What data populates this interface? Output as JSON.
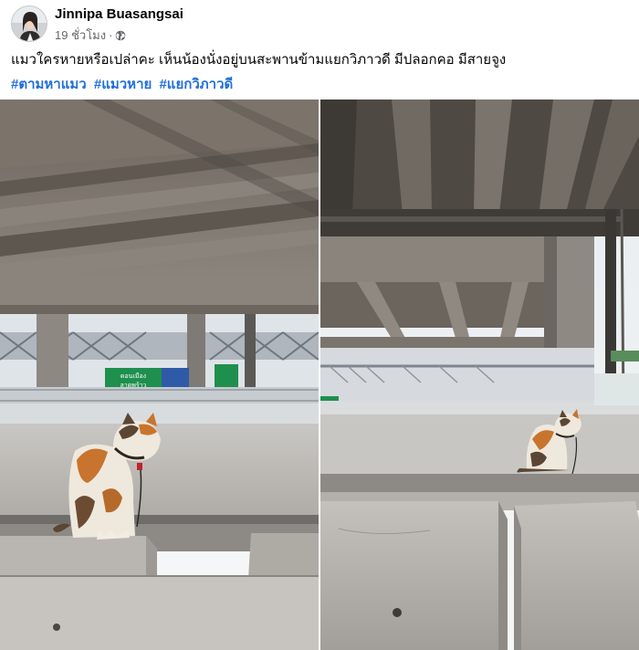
{
  "post": {
    "author_name": "Jinnipa Buasangsai",
    "timestamp": "19 ชั่วโมง",
    "separator": "·",
    "audience_icon": "globe-icon",
    "text": "แมวใครหายหรือเปล่าคะ เห็นน้องนั่งอยู่บนสะพานข้ามแยกวิภาวดี มีปลอกคอ มีสายจูง",
    "hashtags": [
      "#ตามหาแมว",
      "#แมวหาย",
      "#แยกวิภาวดี"
    ]
  },
  "photos": [
    {
      "icon": "cat-photo",
      "signs": [
        "ดอนเมือง",
        "ลาดพร้าว"
      ]
    },
    {
      "icon": "cat-photo"
    }
  ],
  "colors": {
    "link": "#216fdb",
    "secondary_text": "#65676b",
    "concrete": "#b9b6b1",
    "sign_green": "#1f8f4e",
    "sign_blue": "#2f5aa8"
  }
}
